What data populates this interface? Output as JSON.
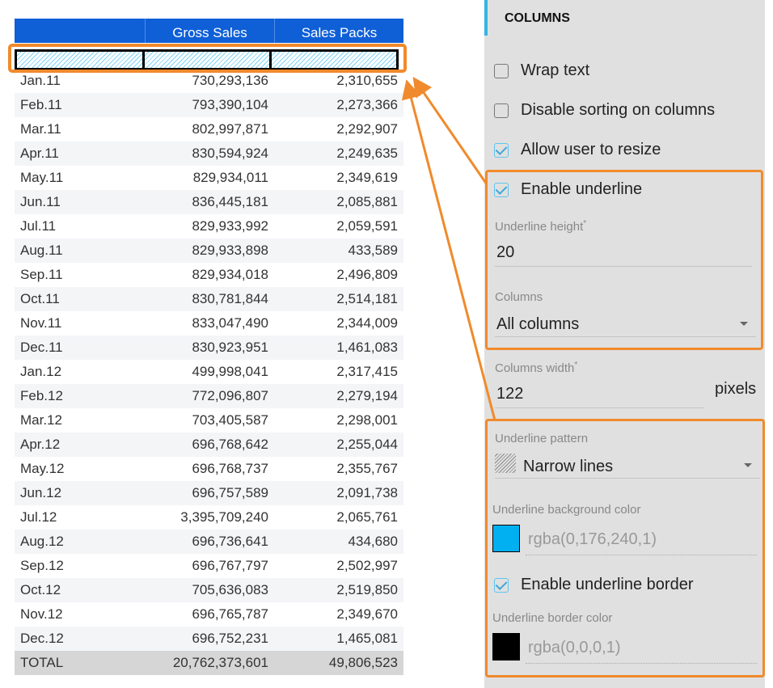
{
  "table": {
    "columns": [
      "",
      "Gross Sales",
      "Sales Packs"
    ],
    "rows": [
      [
        "Jan.11",
        "730,293,136",
        "2,310,655"
      ],
      [
        "Feb.11",
        "793,390,104",
        "2,273,366"
      ],
      [
        "Mar.11",
        "802,997,871",
        "2,292,907"
      ],
      [
        "Apr.11",
        "830,594,924",
        "2,249,635"
      ],
      [
        "May.11",
        "829,934,011",
        "2,349,619"
      ],
      [
        "Jun.11",
        "836,445,181",
        "2,085,881"
      ],
      [
        "Jul.11",
        "829,933,992",
        "2,059,591"
      ],
      [
        "Aug.11",
        "829,933,898",
        "433,589"
      ],
      [
        "Sep.11",
        "829,934,018",
        "2,496,809"
      ],
      [
        "Oct.11",
        "830,781,844",
        "2,514,181"
      ],
      [
        "Nov.11",
        "833,047,490",
        "2,344,009"
      ],
      [
        "Dec.11",
        "830,923,951",
        "1,461,083"
      ],
      [
        "Jan.12",
        "499,998,041",
        "2,317,415"
      ],
      [
        "Feb.12",
        "772,096,807",
        "2,279,194"
      ],
      [
        "Mar.12",
        "703,405,587",
        "2,298,001"
      ],
      [
        "Apr.12",
        "696,768,642",
        "2,255,044"
      ],
      [
        "May.12",
        "696,768,737",
        "2,355,767"
      ],
      [
        "Jun.12",
        "696,757,589",
        "2,091,738"
      ],
      [
        "Jul.12",
        "3,395,709,240",
        "2,065,761"
      ],
      [
        "Aug.12",
        "696,736,641",
        "434,680"
      ],
      [
        "Sep.12",
        "696,767,797",
        "2,502,997"
      ],
      [
        "Oct.12",
        "705,636,083",
        "2,519,850"
      ],
      [
        "Nov.12",
        "696,765,787",
        "2,349,670"
      ],
      [
        "Dec.12",
        "696,752,231",
        "1,465,081"
      ]
    ],
    "total": [
      "TOTAL",
      "20,762,373,601",
      "49,806,523"
    ],
    "header_color": "#0f5fd7"
  },
  "panel": {
    "title": "COLUMNS",
    "wrap_text": {
      "label": "Wrap text",
      "checked": false
    },
    "disable_sorting": {
      "label": "Disable sorting on columns",
      "checked": false
    },
    "allow_resize": {
      "label": "Allow user to resize",
      "checked": true
    },
    "enable_underline": {
      "label": "Enable underline",
      "checked": true
    },
    "underline_height": {
      "label": "Underline height",
      "required_mark": "*",
      "value": "20"
    },
    "columns_select": {
      "label": "Columns",
      "value": "All columns"
    },
    "columns_width": {
      "label": "Columns width",
      "required_mark": "*",
      "value": "122",
      "unit": "pixels"
    },
    "underline_pattern": {
      "label": "Underline pattern",
      "value": "Narrow lines"
    },
    "underline_bg_color": {
      "label": "Underline background color",
      "value": "rgba(0,176,240,1)",
      "swatch": "#00b0f0"
    },
    "enable_underline_border": {
      "label": "Enable underline border",
      "checked": true
    },
    "underline_border_color": {
      "label": "Underline border color",
      "value": "rgba(0,0,0,1)",
      "swatch": "#000000"
    }
  },
  "annotation": {
    "color": "#f08a2c"
  }
}
